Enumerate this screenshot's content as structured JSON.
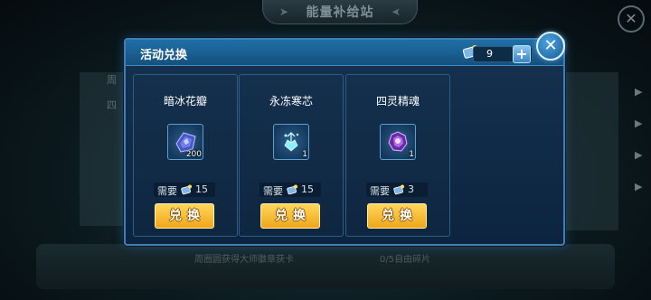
{
  "background": {
    "header_title": "能量补给站",
    "left_partial_label": "四",
    "left_partial_label2": "周",
    "floor_text_left": "周圈圆获得大师徽章获卡",
    "floor_text_right": "0/5自由碎片"
  },
  "dialog": {
    "title": "活动兑换",
    "currency_value": "9",
    "plus_label": "+",
    "close_label": "✕"
  },
  "items": [
    {
      "name": "暗冰花瓣",
      "count": "200",
      "cost_label": "需要",
      "cost_value": "15",
      "button_label": "兑换",
      "icon": "dark-crystal-icon",
      "color": "#5a6fd6"
    },
    {
      "name": "永冻寒芯",
      "count": "1",
      "cost_label": "需要",
      "cost_value": "15",
      "button_label": "兑换",
      "icon": "ice-core-icon",
      "color": "#7fe2f2"
    },
    {
      "name": "四灵精魂",
      "count": "1",
      "cost_label": "需要",
      "cost_value": "3",
      "button_label": "兑换",
      "icon": "spirit-soul-icon",
      "color": "#a45ae0"
    }
  ],
  "colors": {
    "accent": "#3f7fb3",
    "button": "#f0a51a"
  }
}
